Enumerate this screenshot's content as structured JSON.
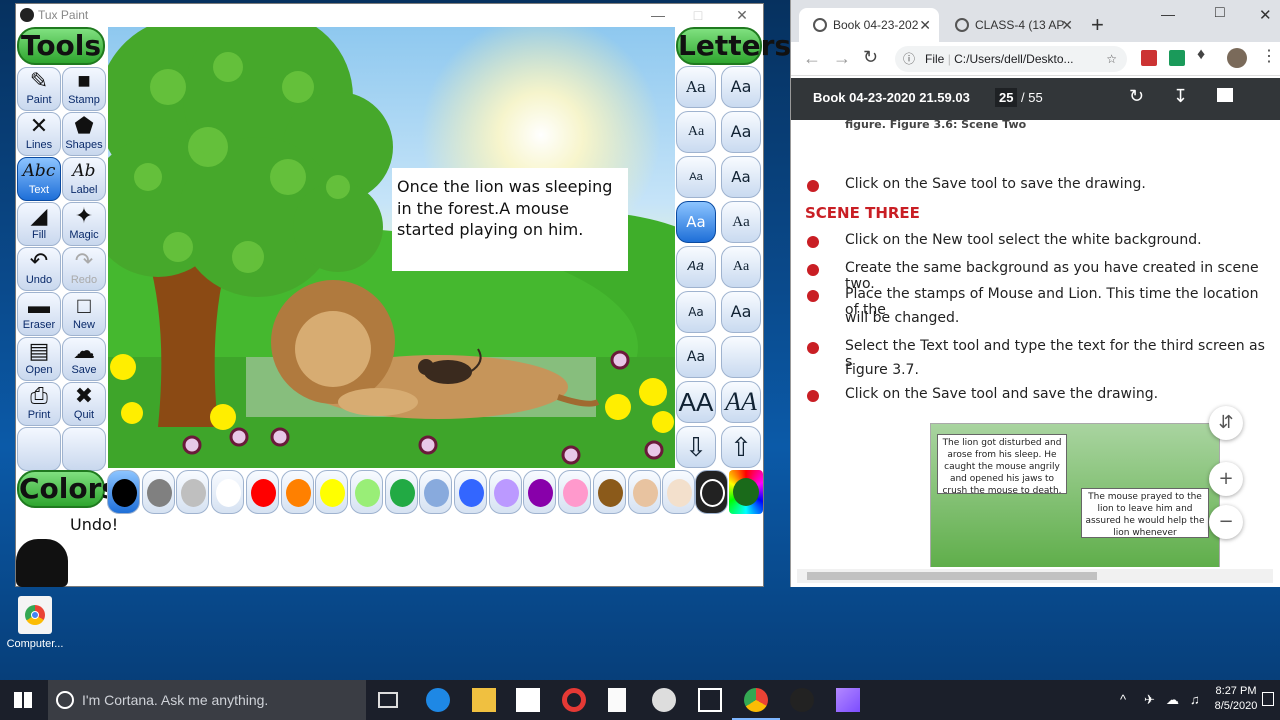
{
  "desktop": {
    "icons": [
      {
        "label": "Computer..."
      }
    ]
  },
  "tuxpaint": {
    "title": "Tux Paint",
    "tools_header": "Tools",
    "letters_header": "Letters",
    "colors_header": "Colors",
    "tools": [
      {
        "label": "Paint",
        "icon": "brush-icon"
      },
      {
        "label": "Stamp",
        "icon": "stamp-icon"
      },
      {
        "label": "Lines",
        "icon": "lines-icon"
      },
      {
        "label": "Shapes",
        "icon": "pentagon-icon"
      },
      {
        "label": "Text",
        "icon": "text-abc-icon",
        "selected": true
      },
      {
        "label": "Label",
        "icon": "label-abc-icon"
      },
      {
        "label": "Fill",
        "icon": "bucket-icon"
      },
      {
        "label": "Magic",
        "icon": "wand-icon"
      },
      {
        "label": "Undo",
        "icon": "undo-icon"
      },
      {
        "label": "Redo",
        "icon": "redo-icon",
        "disabled": true
      },
      {
        "label": "Eraser",
        "icon": "eraser-icon"
      },
      {
        "label": "New",
        "icon": "new-page-icon"
      },
      {
        "label": "Open",
        "icon": "open-book-icon"
      },
      {
        "label": "Save",
        "icon": "save-icon"
      },
      {
        "label": "Print",
        "icon": "printer-icon"
      },
      {
        "label": "Quit",
        "icon": "quit-icon"
      }
    ],
    "canvas_text": [
      "Once the lion was sleeping",
      "in the forest.A mouse",
      "started playing on him."
    ],
    "font_buttons": [
      "Aa",
      "Aa",
      "Aa",
      "Aa",
      "Aa",
      "Aa",
      "Aa",
      "Aa",
      "Aa",
      "Aa",
      "Aa",
      "Aa",
      "Aa",
      ""
    ],
    "size_buttons": [
      "AA",
      "AA"
    ],
    "colors": [
      "#000000",
      "#808080",
      "#bfbfbf",
      "#ffffff",
      "#ff0000",
      "#ff8000",
      "#ffff00",
      "#99ee77",
      "#22aa44",
      "#88aadd",
      "#3366ff",
      "#bb99ff",
      "#8800aa",
      "#ff99cc",
      "#8b5a1a",
      "#e8c3a0",
      "#f3e0cc"
    ],
    "status": "Undo!"
  },
  "chrome": {
    "tabs": [
      {
        "label": "Book 04-23-202",
        "active": true
      },
      {
        "label": "CLASS-4 (13 AP",
        "active": false
      }
    ],
    "url_prefix": "File",
    "url": "C:/Users/dell/Deskto...",
    "pdf": {
      "title": "Book 04-23-2020 21.59.03",
      "page_current": "25",
      "page_total": "/ 55"
    },
    "doc_lines": [
      "Click on the Save tool to save the drawing.",
      "SCENE THREE",
      "Click on the New tool select the white background.",
      "Create the same background as you have created in scene two.",
      "Place the stamps of Mouse and Lion. This time the location of the",
      "will be changed.",
      "Select the Text tool and type the text for the third screen as s",
      "Figure 3.7.",
      "Click on the Save tool and save the drawing."
    ],
    "figure_caption_top": "figure. Figure 3.6: Scene Two",
    "figure_text_1": "The lion got disturbed and arose from his sleep. He caught the mouse angrily and opened his jaws to crush the mouse to death.",
    "figure_text_2": "The mouse prayed to the lion to leave him and assured he would help the lion whenever"
  },
  "taskbar": {
    "cortana": "I'm Cortana. Ask me anything.",
    "time": "8:27 PM",
    "date": "8/5/2020"
  }
}
